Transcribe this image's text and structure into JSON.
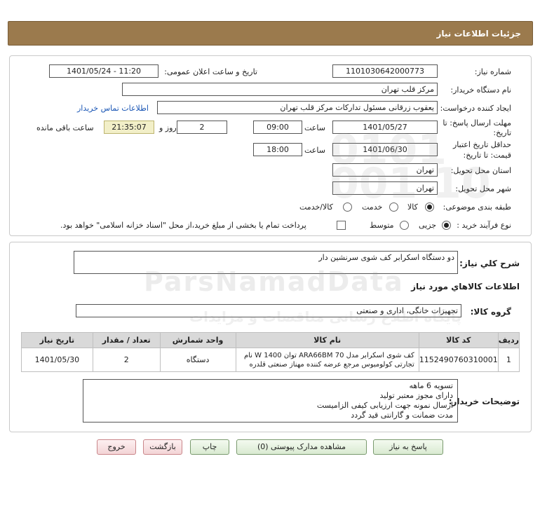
{
  "header": {
    "title": "جزئیات اطلاعات نیاز"
  },
  "form": {
    "need_number_label": "شماره نیاز:",
    "need_number": "1101030642000773",
    "announce_label": "تاریخ و ساعت اعلان عمومی:",
    "announce_value": "1401/05/24 - 11:20",
    "buyer_org_label": "نام دستگاه خریدار:",
    "buyer_org": "مرکز قلب تهران",
    "creator_label": "ایجاد کننده درخواست:",
    "creator": "یعقوب زرقانی مسئول تدارکات مرکز قلب تهران",
    "contact_link": "اطلاعات تماس خریدار",
    "deadline_label_1": "مهلت ارسال پاسخ: تا",
    "deadline_label_2": "تاریخ:",
    "deadline_date": "1401/05/27",
    "time_label": "ساعت",
    "deadline_time": "09:00",
    "days_value": "2",
    "days_label": "روز و",
    "remaining_time": "21:35:07",
    "remaining_label": "ساعت باقی مانده",
    "validity_label_1": "حداقل تاریخ اعتبار",
    "validity_label_2": "قیمت: تا تاریخ:",
    "validity_date": "1401/06/30",
    "validity_time_label": "ساعت",
    "validity_time": "18:00",
    "province_label": "استان محل تحویل:",
    "province": "تهران",
    "city_label": "شهر محل تحویل:",
    "city": "تهران",
    "category_label": "طبقه بندی موضوعی:",
    "category_options": [
      "کالا",
      "خدمت",
      "کالا/خدمت"
    ],
    "process_label": "نوع فرآیند خرید :",
    "process_options": [
      "جزیی",
      "متوسط"
    ],
    "payment_note": "پرداخت تمام یا بخشی از مبلغ خرید،از محل \"اسناد خزانه اسلامی\" خواهد بود."
  },
  "details": {
    "summary_label": "شرح كلي نياز:",
    "summary": "دو دستگاه اسکرابر کف شوی سرنشین دار",
    "goods_info_title": "اطلاعات كالاهاي مورد نياز",
    "goods_group_label": "گروه کالا:",
    "goods_group": "تجهیزات خانگی، اداری و صنعتی",
    "table": {
      "headers": [
        "ردیف",
        "کد کالا",
        "نام کالا",
        "واحد شمارش",
        "تعداد / مقدار",
        "تاریخ نیاز"
      ],
      "rows": [
        {
          "row": "1",
          "code": "1152490760310001",
          "name_line1": "کف شوی اسکرابر مدل ARA66BM 70 توان W 1400 نام",
          "name_line2": "تجارتی کولومبوس مرجع عرضه کننده مهناز صنعتی قلدره",
          "unit": "دستگاه",
          "qty": "2",
          "date": "1401/05/30"
        }
      ]
    },
    "notes_label": "توضیحات خریدار:",
    "notes": [
      "تسویه 6 ماهه",
      "دارای مجوز معتبر تولید",
      "ارسال نمونه جهت ارزیابی کیفی الزامیست",
      "مدت ضمانت و گارانتی قید گردد"
    ]
  },
  "buttons": {
    "reply": "پاسخ به نیاز",
    "attachments": "مشاهده مدارک پیوستی (0)",
    "print": "چاپ",
    "back": "بازگشت",
    "exit": "خروج"
  },
  "watermark": {
    "brand": "ParsNamadData",
    "tagline": "پایگاه اطلاع رسانی مناقصات و مزایدات",
    "phone_fragment": "0101 001 10"
  }
}
